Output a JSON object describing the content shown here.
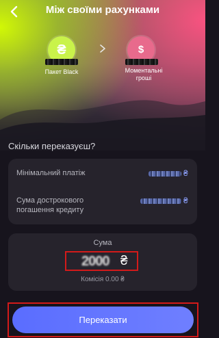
{
  "header": {
    "title": "Між своїми рахунками"
  },
  "accounts": {
    "from": {
      "glyph": "₴",
      "label": "Пакет Black"
    },
    "to": {
      "glyph": "$",
      "label_line1": "Моментальні",
      "label_line2": "гроші"
    }
  },
  "question": "Скільки переказуєш?",
  "limits": {
    "min_payment_label": "Мінімальний платіж",
    "early_repayment_label_line1": "Сума дострокового",
    "early_repayment_label_line2": "погашення кредиту",
    "currency": "₴"
  },
  "amount": {
    "label": "Сума",
    "value": "2000",
    "currency": "₴",
    "commission": "Комісія 0.00 ₴"
  },
  "action": {
    "transfer_label": "Переказати"
  }
}
